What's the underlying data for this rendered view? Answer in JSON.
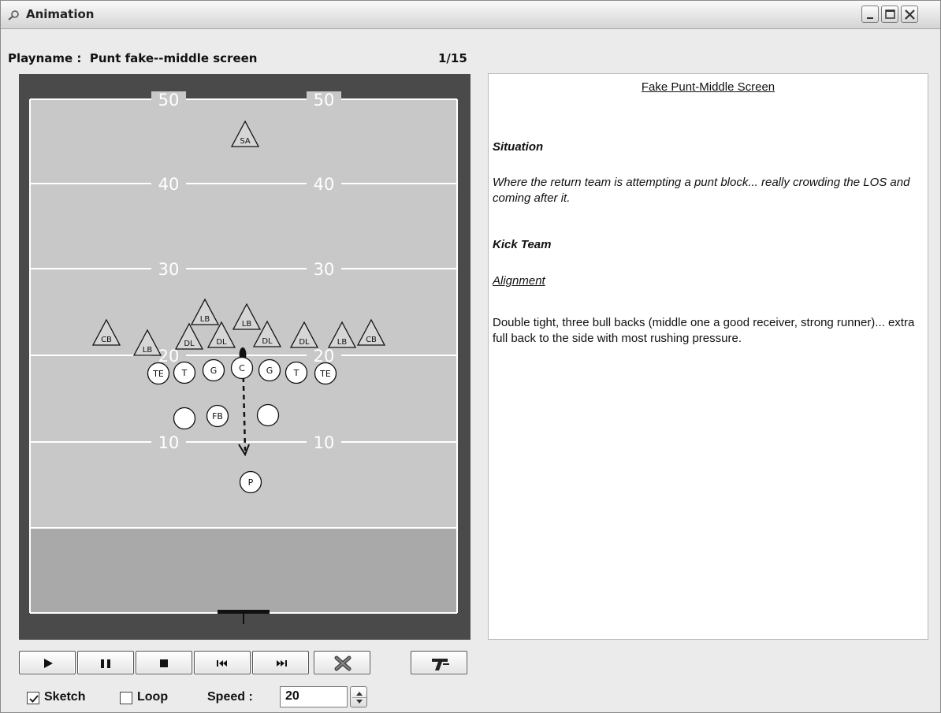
{
  "window": {
    "title": "Animation",
    "minimize_icon": "minimize-icon",
    "maximize_icon": "maximize-icon",
    "close_icon": "close-icon"
  },
  "play": {
    "label": "Playname :",
    "name": "Punt fake--middle screen",
    "counter": "1/15"
  },
  "field": {
    "yard_labels": [
      "50",
      "40",
      "30",
      "20",
      "10"
    ],
    "players": {
      "defense": [
        "SA",
        "LB",
        "LB",
        "CB",
        "LB",
        "DL",
        "DL",
        "DL",
        "DL",
        "LB",
        "CB"
      ],
      "offense": [
        "TE",
        "T",
        "G",
        "C",
        "G",
        "T",
        "TE",
        "FB",
        "P"
      ]
    }
  },
  "notes": {
    "heading": "Fake Punt-Middle Screen",
    "situation_title": "Situation",
    "situation_text": "Where the return team is attempting a punt block... really crowding the LOS and coming after it.",
    "kick_team_title": "Kick Team",
    "alignment_title": "Alignment",
    "alignment_text": "Double tight, three bull backs (middle one a good receiver, strong runner)... extra full back to the side with most rushing pressure."
  },
  "controls": {
    "buttons": [
      "play-icon",
      "pause-icon",
      "stop-icon",
      "skip-back-icon",
      "skip-forward-icon",
      "clear-icon",
      "text-tool-icon"
    ],
    "sketch_label": "Sketch",
    "sketch_checked": true,
    "loop_label": "Loop",
    "loop_checked": false,
    "speed_label": "Speed :",
    "speed_value": "20"
  }
}
